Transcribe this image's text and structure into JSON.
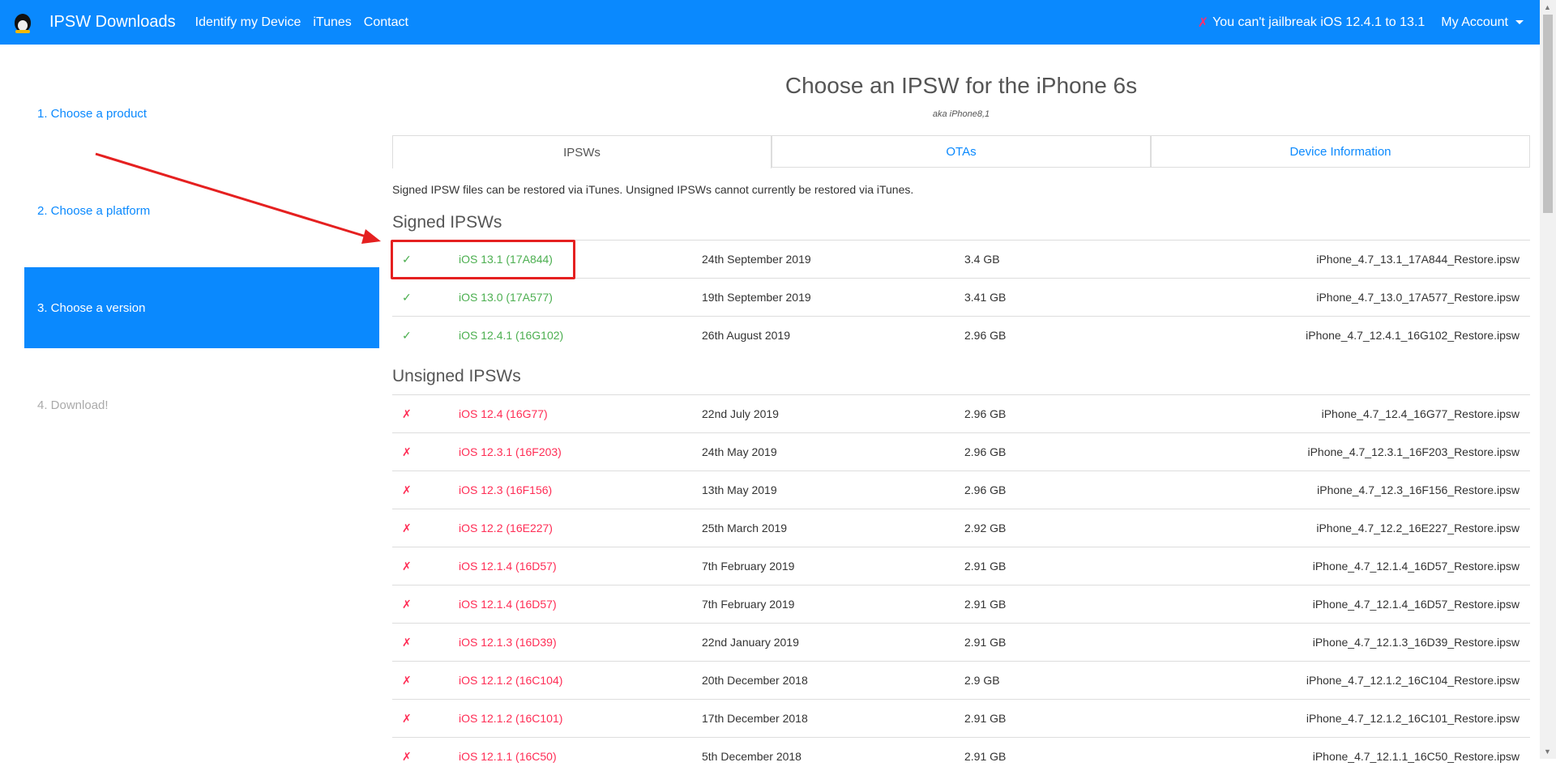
{
  "nav": {
    "brand": "IPSW Downloads",
    "links": [
      "Identify my Device",
      "iTunes",
      "Contact"
    ],
    "alert_icon": "✗",
    "alert": "You can't jailbreak iOS 12.4.1 to 13.1",
    "account": "My Account"
  },
  "sidebar": [
    "1. Choose a product",
    "2. Choose a platform",
    "3. Choose a version",
    "4. Download!"
  ],
  "title": "Choose an IPSW for the iPhone 6s",
  "aka": "aka iPhone8,1",
  "tabs": [
    "IPSWs",
    "OTAs",
    "Device Information"
  ],
  "note": "Signed IPSW files can be restored via iTunes. Unsigned IPSWs cannot currently be restored via iTunes.",
  "signed_heading": "Signed IPSWs",
  "unsigned_heading": "Unsigned IPSWs",
  "signed": [
    {
      "icon": "✓",
      "version": "iOS 13.1 (17A844)",
      "date": "24th September 2019",
      "size": "3.4 GB",
      "file": "iPhone_4.7_13.1_17A844_Restore.ipsw"
    },
    {
      "icon": "✓",
      "version": "iOS 13.0 (17A577)",
      "date": "19th September 2019",
      "size": "3.41 GB",
      "file": "iPhone_4.7_13.0_17A577_Restore.ipsw"
    },
    {
      "icon": "✓",
      "version": "iOS 12.4.1 (16G102)",
      "date": "26th August 2019",
      "size": "2.96 GB",
      "file": "iPhone_4.7_12.4.1_16G102_Restore.ipsw"
    }
  ],
  "unsigned": [
    {
      "icon": "✗",
      "version": "iOS 12.4 (16G77)",
      "date": "22nd July 2019",
      "size": "2.96 GB",
      "file": "iPhone_4.7_12.4_16G77_Restore.ipsw"
    },
    {
      "icon": "✗",
      "version": "iOS 12.3.1 (16F203)",
      "date": "24th May 2019",
      "size": "2.96 GB",
      "file": "iPhone_4.7_12.3.1_16F203_Restore.ipsw"
    },
    {
      "icon": "✗",
      "version": "iOS 12.3 (16F156)",
      "date": "13th May 2019",
      "size": "2.96 GB",
      "file": "iPhone_4.7_12.3_16F156_Restore.ipsw"
    },
    {
      "icon": "✗",
      "version": "iOS 12.2 (16E227)",
      "date": "25th March 2019",
      "size": "2.92 GB",
      "file": "iPhone_4.7_12.2_16E227_Restore.ipsw"
    },
    {
      "icon": "✗",
      "version": "iOS 12.1.4 (16D57)",
      "date": "7th February 2019",
      "size": "2.91 GB",
      "file": "iPhone_4.7_12.1.4_16D57_Restore.ipsw"
    },
    {
      "icon": "✗",
      "version": "iOS 12.1.4 (16D57)",
      "date": "7th February 2019",
      "size": "2.91 GB",
      "file": "iPhone_4.7_12.1.4_16D57_Restore.ipsw"
    },
    {
      "icon": "✗",
      "version": "iOS 12.1.3 (16D39)",
      "date": "22nd January 2019",
      "size": "2.91 GB",
      "file": "iPhone_4.7_12.1.3_16D39_Restore.ipsw"
    },
    {
      "icon": "✗",
      "version": "iOS 12.1.2 (16C104)",
      "date": "20th December 2018",
      "size": "2.9 GB",
      "file": "iPhone_4.7_12.1.2_16C104_Restore.ipsw"
    },
    {
      "icon": "✗",
      "version": "iOS 12.1.2 (16C101)",
      "date": "17th December 2018",
      "size": "2.91 GB",
      "file": "iPhone_4.7_12.1.2_16C101_Restore.ipsw"
    },
    {
      "icon": "✗",
      "version": "iOS 12.1.1 (16C50)",
      "date": "5th December 2018",
      "size": "2.91 GB",
      "file": "iPhone_4.7_12.1.1_16C50_Restore.ipsw"
    }
  ]
}
